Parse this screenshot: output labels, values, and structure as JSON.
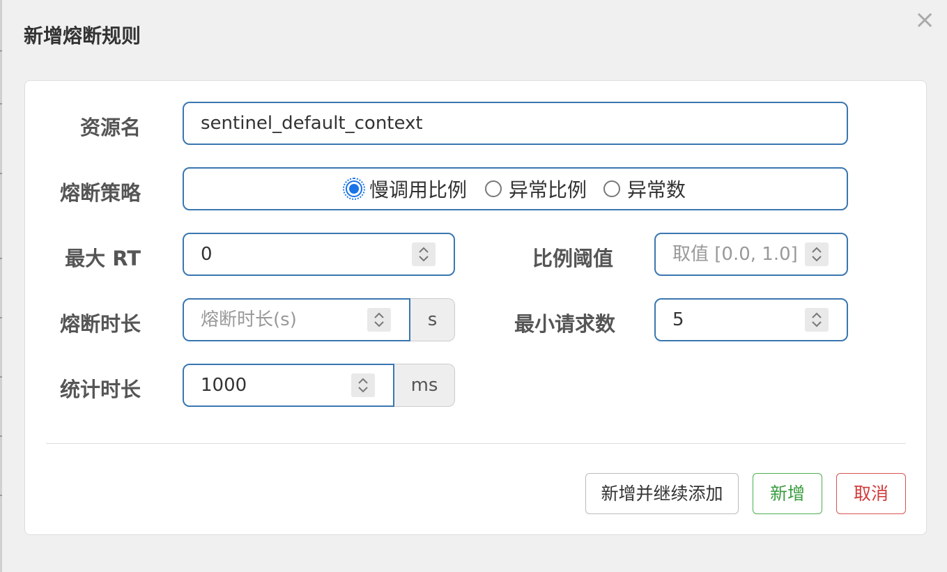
{
  "dialog": {
    "title": "新增熔断规则",
    "close_glyph": "×"
  },
  "form": {
    "resource": {
      "label": "资源名",
      "value": "sentinel_default_context"
    },
    "strategy": {
      "label": "熔断策略",
      "options": [
        "慢调用比例",
        "异常比例",
        "异常数"
      ],
      "selected": "慢调用比例"
    },
    "max_rt": {
      "label": "最大 RT",
      "value": "0"
    },
    "ratio_threshold": {
      "label": "比例阈值",
      "placeholder": "取值 [0.0, 1.0]"
    },
    "break_duration": {
      "label": "熔断时长",
      "placeholder": "熔断时长(s)",
      "unit": "s"
    },
    "min_requests": {
      "label": "最小请求数",
      "value": "5"
    },
    "stat_duration": {
      "label": "统计时长",
      "value": "1000",
      "unit": "ms"
    }
  },
  "buttons": {
    "add_continue": "新增并继续添加",
    "add": "新增",
    "cancel": "取消"
  },
  "colors": {
    "input_border": "#3a76b0",
    "radio_checked": "#1a73e8",
    "success": "#3a9d3e",
    "danger": "#d23c3c"
  },
  "icons": {
    "spinner": "up-down-chevron-icon",
    "radio": "radio-icon",
    "close": "close-icon"
  }
}
